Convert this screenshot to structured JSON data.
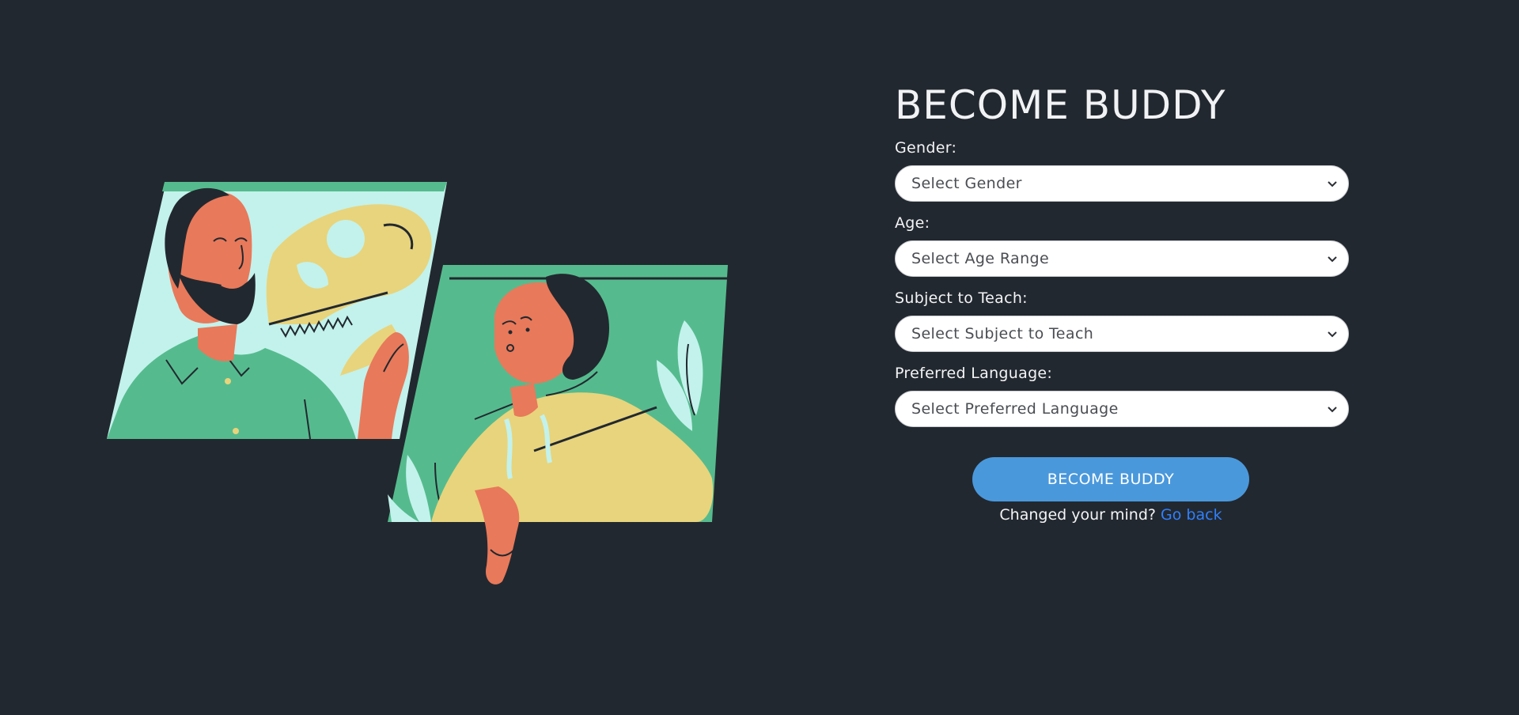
{
  "form": {
    "title": "BECOME BUDDY",
    "fields": [
      {
        "label": "Gender:",
        "selected": "Select Gender"
      },
      {
        "label": "Age:",
        "selected": "Select Age Range"
      },
      {
        "label": "Subject to Teach:",
        "selected": "Select Subject to Teach"
      },
      {
        "label": "Preferred Language:",
        "selected": "Select Preferred Language"
      }
    ],
    "submit_label": "BECOME BUDDY",
    "change_mind_text": "Changed your mind?",
    "go_back_label": "Go back"
  },
  "colors": {
    "background": "#22282f",
    "accent_button": "#4a98dc",
    "link": "#2f80ff",
    "illustration_green": "#55bb8e",
    "illustration_mint": "#c3f2ec",
    "illustration_skin": "#e8795a",
    "illustration_yellow": "#e8d47c"
  },
  "icons": {
    "select_arrow": "chevron-down-icon"
  }
}
